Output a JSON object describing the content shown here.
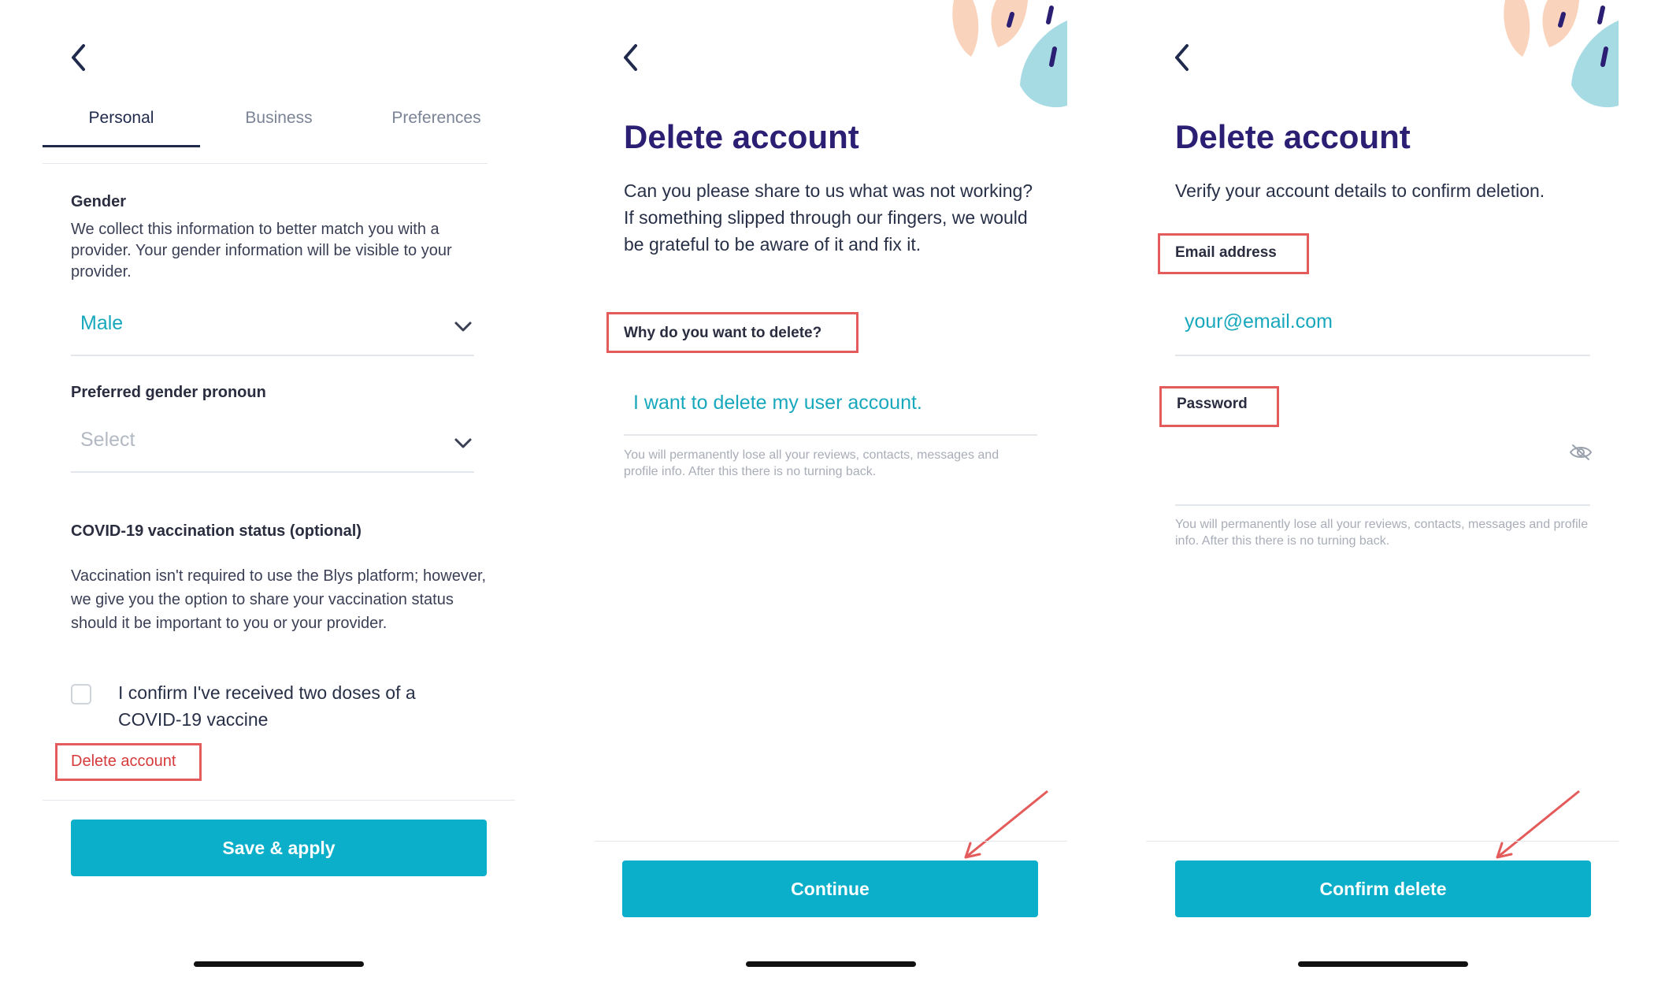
{
  "screen1": {
    "tabs": [
      {
        "label": "Personal"
      },
      {
        "label": "Business"
      },
      {
        "label": "Preferences"
      }
    ],
    "gender": {
      "label": "Gender",
      "description": "We collect this information to better match you with a provider. Your gender information will be visible to your provider.",
      "value": "Male"
    },
    "pronoun": {
      "label": "Preferred gender pronoun",
      "placeholder": "Select"
    },
    "covid": {
      "label": "COVID-19 vaccination status (optional)",
      "description": "Vaccination isn't required to use the Blys platform; however, we give you the option to share your vaccination status should it be important to you or your provider.",
      "checkbox_label": "I confirm I've received two doses of a COVID-19 vaccine",
      "checked": false
    },
    "delete_link": "Delete account",
    "save_button": "Save & apply"
  },
  "screen2": {
    "title": "Delete account",
    "body": "Can you please share to us what was not working? If something slipped through our fingers, we would be grateful to be aware of it and fix it.",
    "reason_label": "Why do you want to delete?",
    "reason_value": "I want to delete my user account.",
    "warning": "You will permanently lose all your reviews, contacts, messages and profile info. After this there is no turning back.",
    "continue_button": "Continue"
  },
  "screen3": {
    "title": "Delete account",
    "body": "Verify your account details to confirm deletion.",
    "email_label": "Email address",
    "email_value": "your@email.com",
    "password_label": "Password",
    "warning": "You will permanently lose all your reviews, contacts, messages and profile info. After this there is no turning back.",
    "confirm_button": "Confirm delete"
  },
  "colors": {
    "accent": "#0bafca",
    "title": "#2b1f74",
    "highlight_box": "#e45b5b",
    "danger": "#d63a3a",
    "input_text": "#18a8bd"
  },
  "icons": [
    "back-arrow-icon",
    "chevron-down-icon",
    "eye-hidden-icon",
    "annotation-arrow-icon"
  ]
}
